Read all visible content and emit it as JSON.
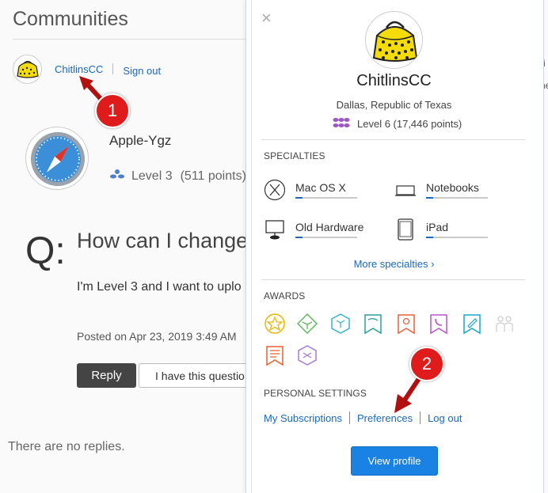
{
  "page": {
    "title": "Communities",
    "user_link": "ChitlinsCC",
    "sign_out": "Sign out",
    "right_fragment": [
      "ri",
      "ne"
    ]
  },
  "question": {
    "author": "Apple-Ygz",
    "level": "Level 3",
    "points": "(511 points)",
    "q_mark": "Q:",
    "title": "How can I change",
    "body": "I'm Level 3 and I want to uplo",
    "posted": "Posted on Apr 23, 2019 3:49 AM",
    "reply_label": "Reply",
    "same_label": "I have this questio",
    "no_replies": "There are no replies."
  },
  "profile": {
    "close": "×",
    "name": "ChitlinsCC",
    "location": "Dallas, Republic of Texas",
    "level": "Level 6 (17,446 points)",
    "specialties_header": "SPECIALTIES",
    "specialties": [
      {
        "label": "Mac OS X",
        "icon": "macos-x-icon"
      },
      {
        "label": "Notebooks",
        "icon": "notebook-icon"
      },
      {
        "label": "Old Hardware",
        "icon": "monitor-icon"
      },
      {
        "label": "iPad",
        "icon": "ipad-icon"
      }
    ],
    "more_specialties": "More specialties ›",
    "awards_header": "AWARDS",
    "awards": [
      {
        "name": "star-award-icon",
        "color": "#e8b800"
      },
      {
        "name": "book-award-icon",
        "color": "#5cb85c"
      },
      {
        "name": "cube-award-icon",
        "color": "#36b5c8"
      },
      {
        "name": "flag-award-icon",
        "color": "#2aa198"
      },
      {
        "name": "map-pin-award-icon",
        "color": "#e8603c"
      },
      {
        "name": "phone-award-icon",
        "color": "#b655c8"
      },
      {
        "name": "pencil-award-icon",
        "color": "#1aa6c8"
      },
      {
        "name": "people-award-icon",
        "color": "#cfcfcf"
      },
      {
        "name": "list-award-icon",
        "color": "#e8602c"
      },
      {
        "name": "gear-award-icon",
        "color": "#a77ad6"
      }
    ],
    "settings_header": "PERSONAL SETTINGS",
    "subscriptions": "My Subscriptions",
    "preferences": "Preferences",
    "log_out": "Log out",
    "view_profile": "View profile"
  },
  "annotations": {
    "badge1": "1",
    "badge2": "2",
    "color": "#e01b1b"
  },
  "colors": {
    "link": "#1a69b9",
    "level_icon": "#4a7fd4",
    "level6_icon": "#9b59c6",
    "view_button": "#1a82e2"
  }
}
